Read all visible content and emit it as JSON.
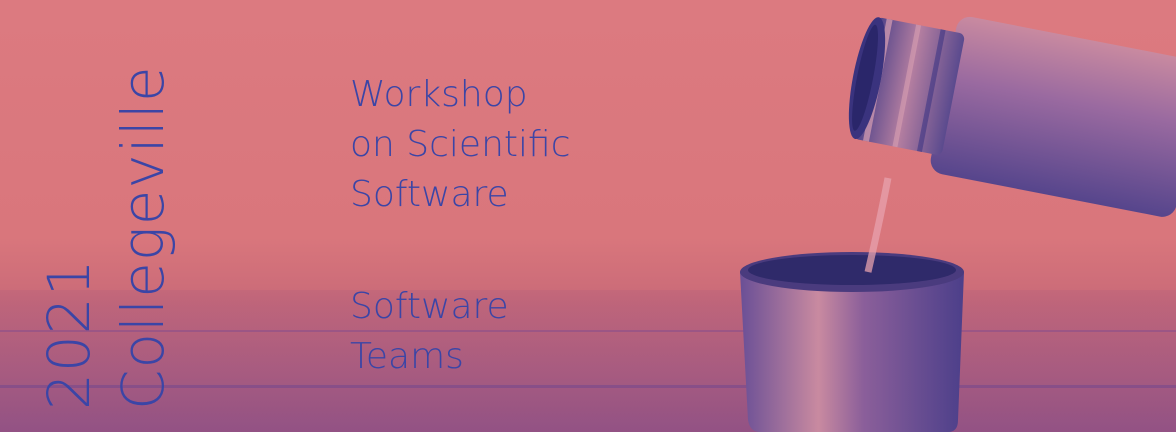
{
  "banner": {
    "year": "2021",
    "city": "Collegeville",
    "title_lines": [
      "Workshop",
      "on Scientific",
      "Software"
    ],
    "subtitle_lines": [
      "Software",
      "Teams"
    ]
  },
  "colors": {
    "background": "#d9737a",
    "text": "#3b45a6",
    "metal_dark": "#5a4a8e",
    "metal_light": "#c98aa0"
  }
}
